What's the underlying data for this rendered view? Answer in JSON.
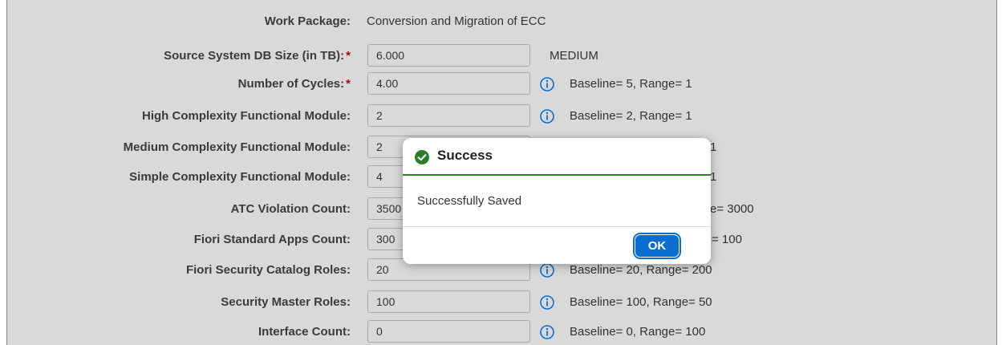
{
  "form": {
    "work_package": {
      "label": "Work Package:",
      "value": "Conversion and Migration of ECC"
    },
    "fields": [
      {
        "label": "Source System DB Size (in TB):",
        "required": true,
        "value": "6.000",
        "tier": "MEDIUM"
      },
      {
        "label": "Number of Cycles:",
        "required": true,
        "value": "4.00",
        "hint": "Baseline= 5, Range= 1"
      },
      {
        "label": "High Complexity Functional Module:",
        "value": "2",
        "hint": "Baseline= 2, Range= 1"
      },
      {
        "label": "Medium Complexity Functional Module:",
        "value": "2",
        "hint": "1"
      },
      {
        "label": "Simple Complexity Functional Module:",
        "value": "4",
        "hint": "1"
      },
      {
        "label": "ATC Violation Count:",
        "value": "3500",
        "hint": "e= 3000"
      },
      {
        "label": "Fiori Standard Apps Count:",
        "value": "300",
        "hint": "= 100"
      },
      {
        "label": "Fiori Security Catalog Roles:",
        "value": "20",
        "hint": "Baseline= 20, Range= 200"
      },
      {
        "label": "Security Master Roles:",
        "value": "100",
        "hint": "Baseline= 100, Range= 50"
      },
      {
        "label": "Interface Count:",
        "value": "0",
        "hint": "Baseline= 0, Range= 100"
      }
    ],
    "required_marker": "*"
  },
  "dialog": {
    "title": "Success",
    "message": "Successfully Saved",
    "ok_label": "OK"
  },
  "colors": {
    "overlay_bg": "#d9d9d9",
    "info_icon": "#0a6ed1",
    "success_green": "#2b7d2b",
    "button_blue": "#0a6ed1",
    "required_red": "#bb0000"
  }
}
